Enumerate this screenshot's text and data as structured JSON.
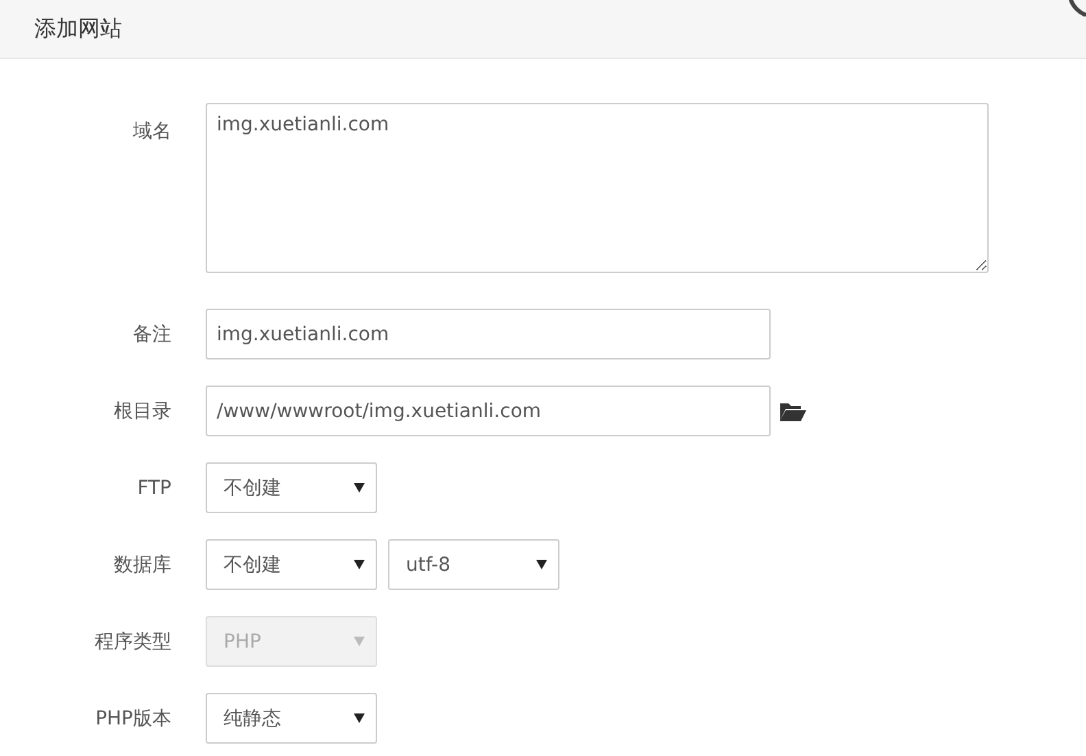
{
  "dialog": {
    "title": "添加网站"
  },
  "fields": [
    {
      "kind": "textarea",
      "label": "域名",
      "value": "img.xuetianli.com"
    },
    {
      "kind": "input",
      "label": "备注",
      "value": "img.xuetianli.com"
    },
    {
      "kind": "path",
      "label": "根目录",
      "value": "/www/wwwroot/img.xuetianli.com"
    },
    {
      "kind": "select",
      "label": "FTP",
      "selects": [
        {
          "value": "不创建",
          "disabled": false
        }
      ]
    },
    {
      "kind": "select",
      "label": "数据库",
      "selects": [
        {
          "value": "不创建",
          "disabled": false
        },
        {
          "value": "utf-8",
          "disabled": false
        }
      ]
    },
    {
      "kind": "select",
      "label": "程序类型",
      "selects": [
        {
          "value": "PHP",
          "disabled": true
        }
      ]
    },
    {
      "kind": "select",
      "label": "PHP版本",
      "selects": [
        {
          "value": "纯静态",
          "disabled": false
        }
      ]
    }
  ]
}
